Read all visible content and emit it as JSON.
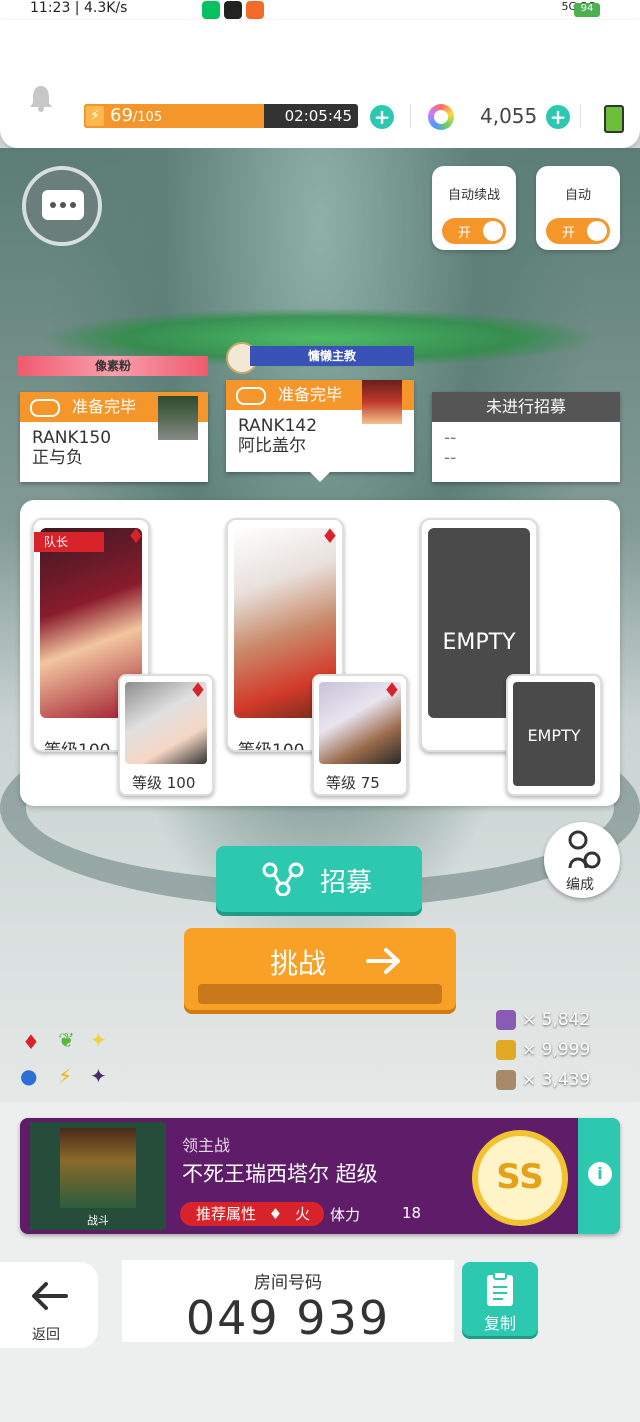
{
  "statusbar": {
    "time": "11:23 | 4.3K/s",
    "signals": "5G 3G",
    "battery": "94"
  },
  "topbar": {
    "stamina_current": "69",
    "stamina_max": "/105",
    "stamina_fraction": 0.657,
    "timer": "02:05:45",
    "gems": "4,055"
  },
  "toggles": {
    "auto_continue": {
      "label": "自动续战",
      "state": "开"
    },
    "auto": {
      "label": "自动",
      "state": "开"
    }
  },
  "players": [
    {
      "ribbon": "像素粉",
      "status": "准备完毕",
      "rank": "RANK150",
      "name": "正与负"
    },
    {
      "ribbon": "慵懒主教",
      "status": "准备完毕",
      "rank": "RANK142",
      "name": "阿比盖尔"
    },
    {
      "status": "未进行招募",
      "rank": "--",
      "name": "--"
    }
  ],
  "party": {
    "captain_label": "队长",
    "slots": [
      {
        "main_level": "等级100",
        "sub_level": "等级 100"
      },
      {
        "main_level": "等级100",
        "sub_level": "等级 75"
      },
      {
        "main_label": "EMPTY",
        "sub_label": "EMPTY"
      }
    ]
  },
  "buttons": {
    "recruit": "招募",
    "challenge": "挑战",
    "edit": "编成",
    "back": "返回",
    "copy": "复制"
  },
  "medals": [
    {
      "count": "× 5,842",
      "color": "#8a5bb5"
    },
    {
      "count": "× 9,999",
      "color": "#e0a823"
    },
    {
      "count": "× 3,439",
      "color": "#a88a6a"
    }
  ],
  "boss": {
    "category": "领主战",
    "name": "不死王瑞西塔尔 超级",
    "img_caption": "战斗",
    "recommend_label": "推荐属性",
    "element": "火",
    "stamina_label": "体力",
    "stamina_cost": "18",
    "grade": "SS"
  },
  "room": {
    "label": "房间号码",
    "number": "049 939"
  }
}
